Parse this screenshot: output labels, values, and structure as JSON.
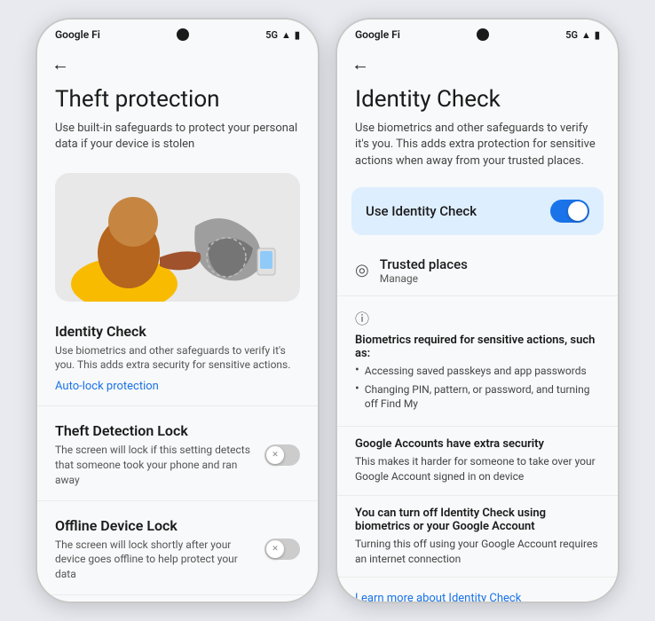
{
  "phone1": {
    "status_bar": {
      "carrier": "Google Fi",
      "network": "5G",
      "signal_icon": "▲"
    },
    "back_arrow": "←",
    "title": "Theft protection",
    "subtitle": "Use built-in safeguards to protect your personal data if your device is stolen",
    "sections": [
      {
        "id": "identity-check",
        "title": "Identity Check",
        "desc": "Use biometrics and other safeguards to verify it's you. This adds extra security for sensitive actions.",
        "link": "Auto-lock protection",
        "has_link": true,
        "has_toggle": false
      },
      {
        "id": "theft-detection",
        "title": "Theft Detection Lock",
        "desc": "The screen will lock if this setting detects that someone took your phone and ran away",
        "has_toggle": true,
        "toggle_on": false
      },
      {
        "id": "offline-device-lock",
        "title": "Offline Device Lock",
        "desc": "The screen will lock shortly after your device goes offline to help protect your data",
        "has_toggle": true,
        "toggle_on": false
      }
    ]
  },
  "phone2": {
    "status_bar": {
      "carrier": "Google Fi",
      "network": "5G"
    },
    "back_arrow": "←",
    "title": "Identity Check",
    "subtitle": "Use biometrics and other safeguards to verify it's you. This adds extra protection for sensitive actions when away from your trusted places.",
    "toggle_card": {
      "label": "Use Identity Check",
      "enabled": true
    },
    "trusted_places": {
      "title": "Trusted places",
      "manage": "Manage"
    },
    "biometrics_section": {
      "heading": "Biometrics required for sensitive actions, such as:",
      "bullets": [
        "Accessing saved passkeys and app passwords",
        "Changing PIN, pattern, or password, and turning off Find My"
      ]
    },
    "extra_security": {
      "title": "Google Accounts have extra security",
      "desc": "This makes it harder for someone to take over your Google Account signed in on device"
    },
    "turn_off": {
      "title": "You can turn off Identity Check using biometrics or your Google Account",
      "desc": "Turning this off using your Google Account requires an internet connection"
    },
    "learn_more": {
      "text": "Learn more about Identity Check"
    }
  }
}
